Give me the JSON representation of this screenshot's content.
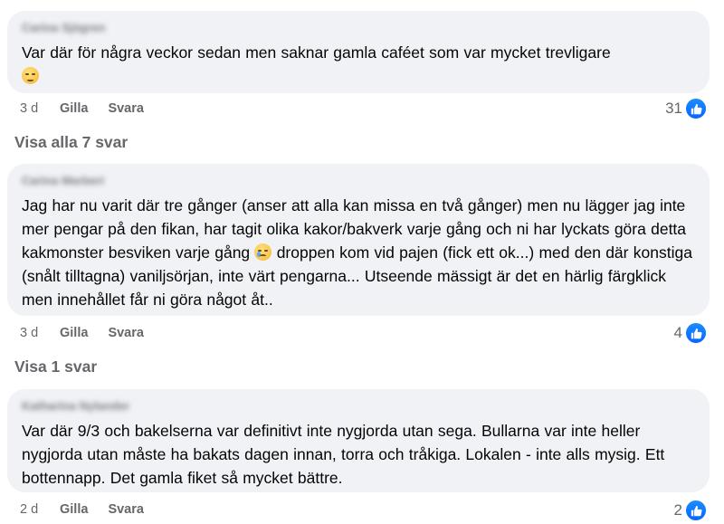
{
  "comments": [
    {
      "author": "Carina Sjögren",
      "text": "Var där för några veckor sedan men saknar gamla caféet som var mycket trevligare",
      "emoji": "pensive-face",
      "time": "3 d",
      "like_label": "Gilla",
      "reply_label": "Svara",
      "likes": "31"
    },
    {
      "author": "Carina Marberi",
      "text_parts": [
        "Jag har nu varit där tre gånger (anser att alla kan missa en två gånger) men nu lägger jag inte mer pengar på den fikan, har tagit olika kakor/bakverk varje gång och ni har lyckats göra detta kakmonster besviken varje gång",
        " droppen kom vid pajen (fick ett ok...) med den där konstiga (snålt tilltagna) vaniljsörjan, inte värt pengarna... Utseende mässigt är det en härlig färgklick men innehållet får ni göra något åt.."
      ],
      "emoji": "crying-face",
      "time": "3 d",
      "like_label": "Gilla",
      "reply_label": "Svara",
      "likes": "4"
    },
    {
      "author": "Katharina Nylander",
      "text": "Var där 9/3 och bakelserna var definitivt inte nygjorda utan sega. Bullarna var inte heller nygjorda utan måste ha bakats dagen innan, torra och tråkiga. Lokalen - inte alls mysig. Ett bottennapp. Det gamla fiket så mycket bättre.",
      "time": "2 d",
      "like_label": "Gilla",
      "reply_label": "Svara",
      "likes": "2"
    }
  ],
  "view_replies": [
    "Visa alla 7 svar",
    "Visa 1 svar"
  ],
  "colors": {
    "like_blue": "#0866ff",
    "bubble_bg": "#f0f2f5",
    "meta_gray": "#65676b"
  },
  "icons": {
    "like": "thumbs-up-icon"
  }
}
